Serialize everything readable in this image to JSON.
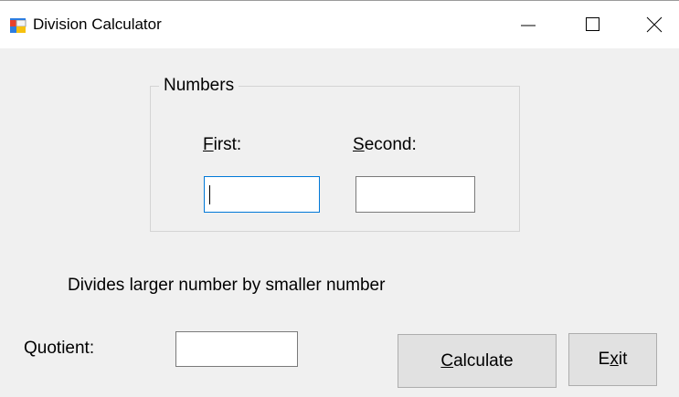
{
  "window": {
    "title": "Division Calculator"
  },
  "numbers_group": {
    "legend": "Numbers",
    "first_label": {
      "mnemonic": "F",
      "rest": "irst:"
    },
    "second_label": {
      "mnemonic": "S",
      "rest": "econd:"
    },
    "first_value": "",
    "second_value": ""
  },
  "description": "Divides larger number by smaller number",
  "quotient": {
    "label": "Quotient:",
    "value": ""
  },
  "buttons": {
    "calculate": {
      "mnemonic": "C",
      "rest": "alculate"
    },
    "exit": {
      "before": "E",
      "mnemonic": "x",
      "after": "it"
    }
  },
  "icons": {
    "app": "windows-form-icon",
    "minimize": "minimize-icon",
    "maximize": "maximize-icon",
    "close": "close-icon"
  },
  "colors": {
    "focus_border": "#0078d7",
    "window_bg": "#f0f0f0",
    "button_bg": "#e1e1e1"
  }
}
